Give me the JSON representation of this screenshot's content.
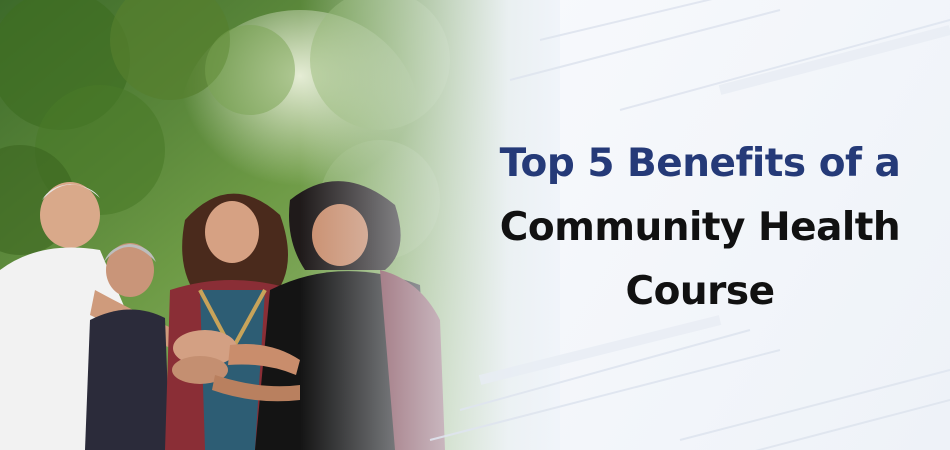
{
  "headline": {
    "line_1": "Top 5 Benefits of a",
    "line_2": "Community Health",
    "line_3": "Course"
  },
  "colors": {
    "headline_accent": "#253a78",
    "headline_text": "#111111",
    "background": "#eef2f8"
  }
}
